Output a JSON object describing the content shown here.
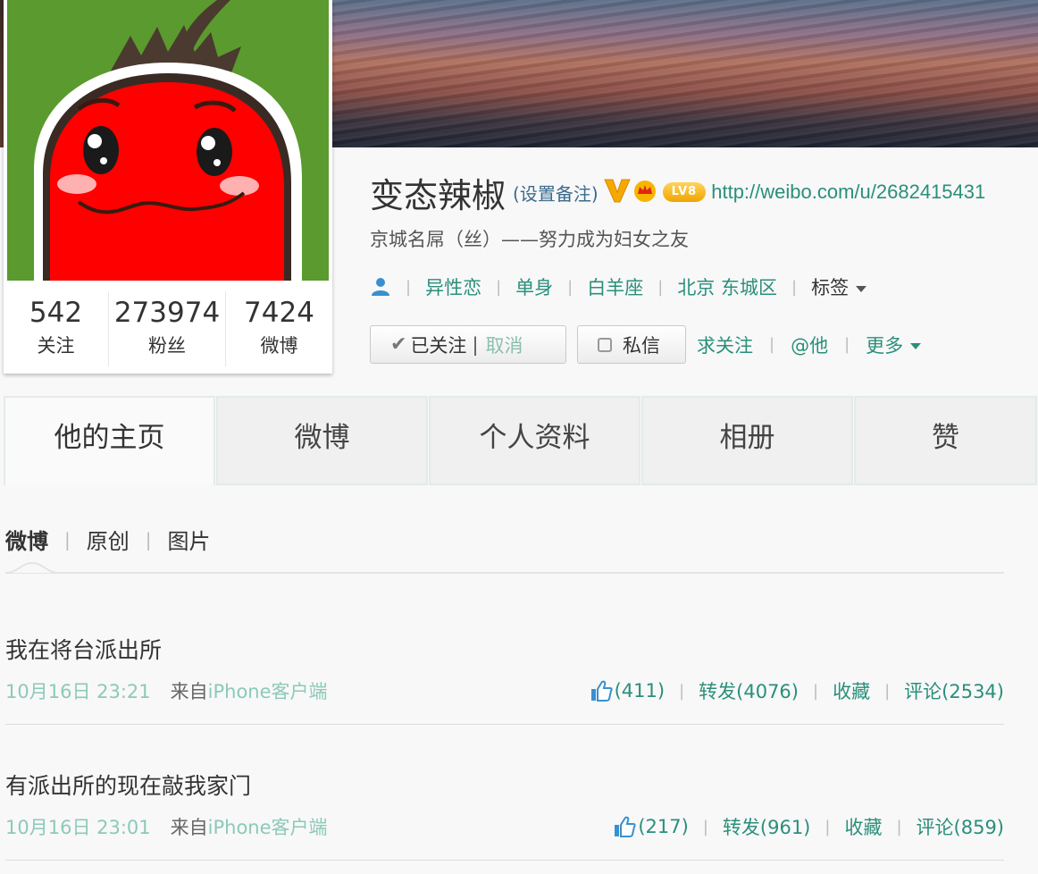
{
  "profile": {
    "name": "变态辣椒",
    "remark": "(设置备注)",
    "level": "LV8",
    "url": "http://weibo.com/u/2682415431",
    "bio": "京城名屌（丝）——努力成为妇女之友",
    "tags": [
      "异性恋",
      "单身",
      "白羊座",
      "北京 东城区"
    ],
    "tags_dropdown": "标签"
  },
  "counts": [
    {
      "value": "542",
      "label": "关注"
    },
    {
      "value": "273974",
      "label": "粉丝"
    },
    {
      "value": "7424",
      "label": "微博"
    }
  ],
  "actions": {
    "followed": "已关注",
    "cancel": "取消",
    "message": "私信",
    "ask_follow": "求关注",
    "mention": "@他",
    "more": "更多"
  },
  "tabs": [
    "他的主页",
    "微博",
    "个人资料",
    "相册",
    "赞"
  ],
  "subtabs": [
    "微博",
    "原创",
    "图片"
  ],
  "posts": [
    {
      "text": "我在将台派出所",
      "time": "10月16日 23:21",
      "from_label": "来自",
      "source": "iPhone客户端",
      "likes": "(411)",
      "repost": "转发(4076)",
      "favorite": "收藏",
      "comment": "评论(2534)"
    },
    {
      "text": "有派出所的现在敲我家门",
      "time": "10月16日 23:01",
      "from_label": "来自",
      "source": "iPhone客户端",
      "likes": "(217)",
      "repost": "转发(961)",
      "favorite": "收藏",
      "comment": "评论(859)"
    }
  ],
  "colors": {
    "link": "#2a8f7b",
    "time": "#8cc9b9",
    "avatar_bg": "#5a9a2e",
    "pepper": "#ff0000",
    "level_badge": "#f0a400"
  },
  "icons": [
    "verified-v-icon",
    "crown-icon",
    "person-icon",
    "checkmark-icon",
    "checkbox-icon",
    "thumb-up-icon",
    "caret-down-icon"
  ]
}
